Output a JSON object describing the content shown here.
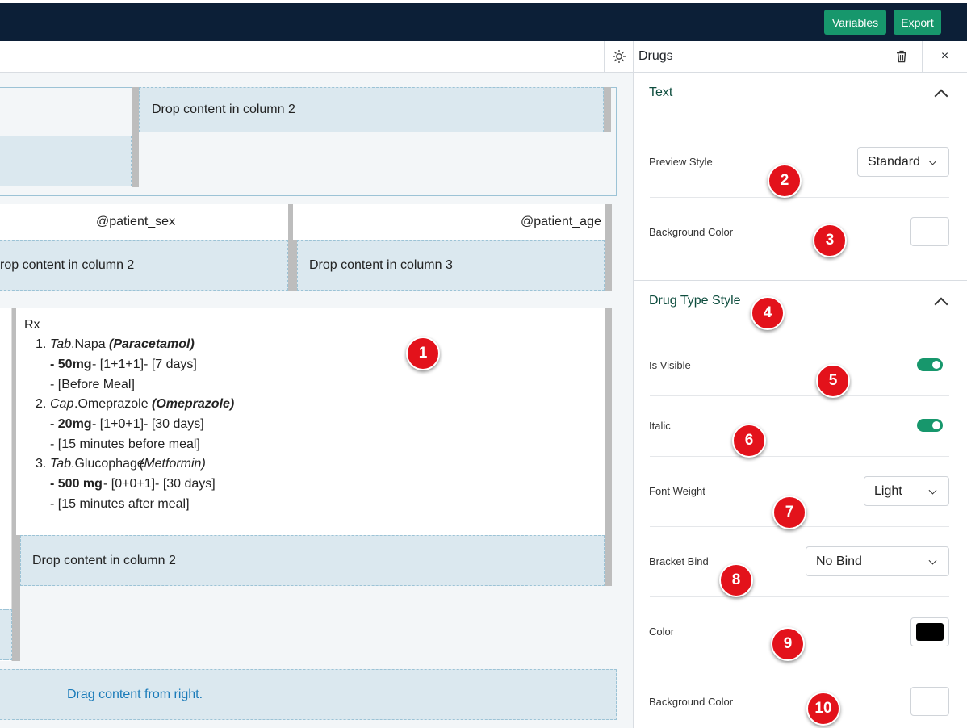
{
  "header": {
    "variables_label": "Variables",
    "export_label": "Export"
  },
  "toolbar": {
    "panel_title": "Drugs",
    "close_glyph": "×"
  },
  "canvas": {
    "drop_col2_top": "Drop content in column 2",
    "patient_sex": "@patient_sex",
    "patient_age": "@patient_age",
    "drop_col2_mid": "rop content in column 2",
    "drop_col3_mid": "Drop content in column 3",
    "rx_heading": "Rx",
    "drugs": [
      {
        "num": "1.",
        "type": "Tab",
        "name": " .Napa",
        "generic": "(Paracetamol)",
        "dose": "- 50mg",
        "schedule": "- [1+1+1]- [7 days]",
        "note": "- [Before Meal]"
      },
      {
        "num": "2.",
        "type": "Cap",
        "name": " .Omeprazole",
        "generic": "(Omeprazole)",
        "dose": "- 20mg",
        "schedule": "- [1+0+1]- [30 days]",
        "note": "- [15 minutes before meal]"
      },
      {
        "num": "3.",
        "type": "Tab",
        "name": " .Glucophage",
        "generic": "(Metformin)",
        "dose": "- 500 mg",
        "schedule": "- [0+0+1]- [30 days]",
        "note": "- [15 minutes after meal]"
      }
    ],
    "drop_col2_bottom": "Drop content in column 2",
    "drag_hint": "Drag content from right."
  },
  "panel": {
    "text_section": {
      "title": "Text",
      "preview_style_label": "Preview Style",
      "preview_style_value": "Standard",
      "background_color_label": "Background Color",
      "background_color_value": "#ffffff"
    },
    "drug_type_section": {
      "title": "Drug Type Style",
      "is_visible_label": "Is Visible",
      "is_visible": true,
      "italic_label": "Italic",
      "italic": true,
      "font_weight_label": "Font Weight",
      "font_weight_value": "Light",
      "bracket_bind_label": "Bracket Bind",
      "bracket_bind_value": "No Bind",
      "color_label": "Color",
      "color_value": "#000000",
      "background_color_label": "Background Color",
      "background_color_value": "#ffffff"
    }
  },
  "markers": [
    "1",
    "2",
    "3",
    "4",
    "5",
    "6",
    "7",
    "8",
    "9",
    "10"
  ],
  "colors": {
    "topbar": "#0c1f37",
    "accent_green": "#17976c",
    "marker_red": "#e3121b",
    "link_blue": "#1a7bb9"
  }
}
